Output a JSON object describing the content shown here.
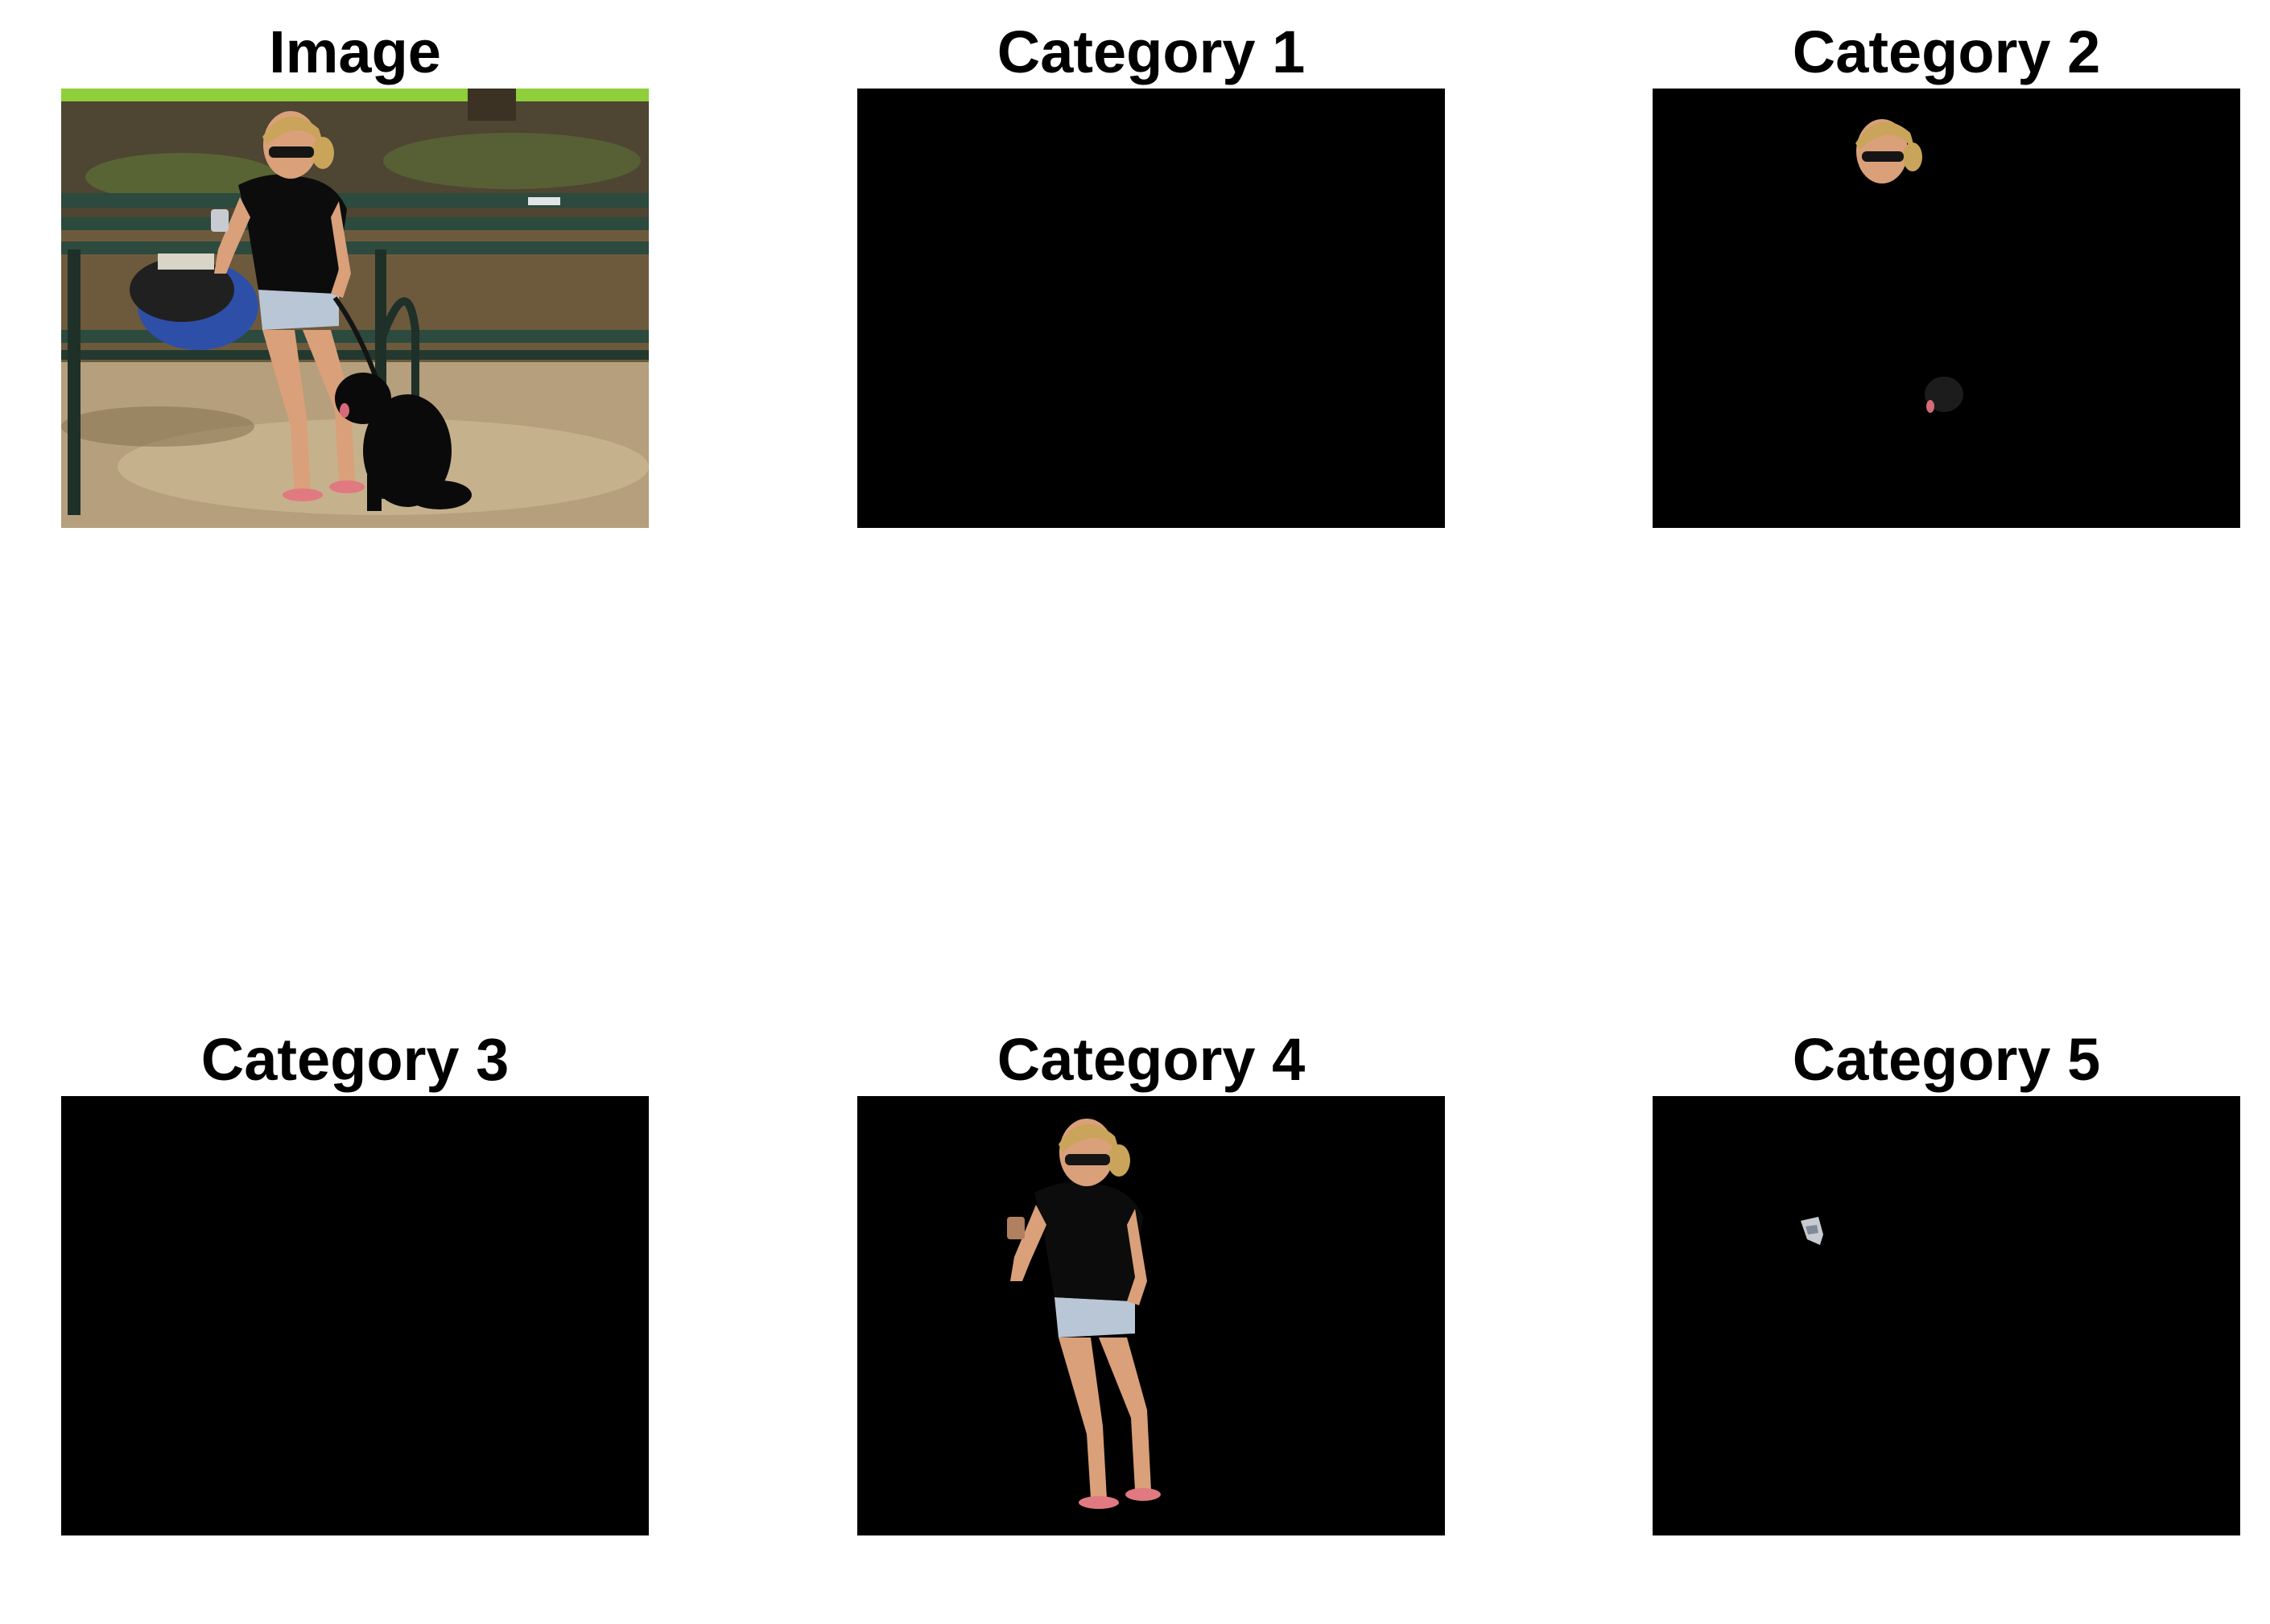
{
  "panels": [
    {
      "title": "Image"
    },
    {
      "title": "Category 1"
    },
    {
      "title": "Category 2"
    },
    {
      "title": "Category 3"
    },
    {
      "title": "Category 4"
    },
    {
      "title": "Category 5"
    }
  ],
  "colors": {
    "background": "#ffffff",
    "mask_background": "#000000",
    "grass": "#5b8a2a",
    "ground": "#8f7a58",
    "bench": "#2c4a3e",
    "skin": "#d9a07a",
    "hair": "#c9a45a",
    "shirt": "#0c0c0c",
    "shorts": "#b9c6d6",
    "bag": "#2d4fa8",
    "dog": "#0a0a0a",
    "phone": "#c8ccd2"
  }
}
